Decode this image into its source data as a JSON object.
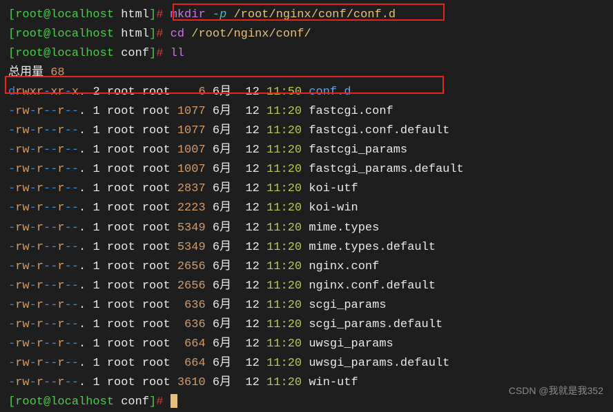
{
  "prompt1": {
    "bracket_open": "[",
    "user_host": "root@localhost",
    "dir": " html",
    "bracket_close": "]",
    "hash": "# ",
    "cmd": "mkdir ",
    "flag": "-p ",
    "path": "/root/nginx/conf/conf.d"
  },
  "prompt2": {
    "bracket_open": "[",
    "user_host": "root@localhost",
    "dir": " html",
    "bracket_close": "]",
    "hash": "# ",
    "cmd": "cd ",
    "path": "/root/nginx/conf/"
  },
  "prompt3": {
    "bracket_open": "[",
    "user_host": "root@localhost",
    "dir": " conf",
    "bracket_close": "]",
    "hash": "# ",
    "cmd": "ll"
  },
  "total_label": "总用量 ",
  "total_num": "68",
  "entries": [
    {
      "perm_d": "d",
      "perm_rwx": "rwx",
      "perm_r1": "r",
      "perm_dash1": "-",
      "perm_x1": "x",
      "perm_r2": "r",
      "perm_dash2": "-",
      "perm_x2": "x",
      "perm_end": ". ",
      "links": "2",
      "owner": " root root    ",
      "size": "6",
      "month": " 6月  ",
      "day": "12 ",
      "time": "11:50",
      "sep": " ",
      "name": "conf.d",
      "is_dir": true
    },
    {
      "perm": "-rw-r--r--. ",
      "links": "1",
      "owner": " root root ",
      "size": "1077",
      "month": " 6月  ",
      "day": "12 ",
      "time": "11:20",
      "sep": " ",
      "name": "fastcgi.conf"
    },
    {
      "perm": "-rw-r--r--. ",
      "links": "1",
      "owner": " root root ",
      "size": "1077",
      "month": " 6月  ",
      "day": "12 ",
      "time": "11:20",
      "sep": " ",
      "name": "fastcgi.conf.default"
    },
    {
      "perm": "-rw-r--r--. ",
      "links": "1",
      "owner": " root root ",
      "size": "1007",
      "month": " 6月  ",
      "day": "12 ",
      "time": "11:20",
      "sep": " ",
      "name": "fastcgi_params"
    },
    {
      "perm": "-rw-r--r--. ",
      "links": "1",
      "owner": " root root ",
      "size": "1007",
      "month": " 6月  ",
      "day": "12 ",
      "time": "11:20",
      "sep": " ",
      "name": "fastcgi_params.default"
    },
    {
      "perm": "-rw-r--r--. ",
      "links": "1",
      "owner": " root root ",
      "size": "2837",
      "month": " 6月  ",
      "day": "12 ",
      "time": "11:20",
      "sep": " ",
      "name": "koi-utf"
    },
    {
      "perm": "-rw-r--r--. ",
      "links": "1",
      "owner": " root root ",
      "size": "2223",
      "month": " 6月  ",
      "day": "12 ",
      "time": "11:20",
      "sep": " ",
      "name": "koi-win"
    },
    {
      "perm": "-rw-r--r--. ",
      "links": "1",
      "owner": " root root ",
      "size": "5349",
      "month": " 6月  ",
      "day": "12 ",
      "time": "11:20",
      "sep": " ",
      "name": "mime.types"
    },
    {
      "perm": "-rw-r--r--. ",
      "links": "1",
      "owner": " root root ",
      "size": "5349",
      "month": " 6月  ",
      "day": "12 ",
      "time": "11:20",
      "sep": " ",
      "name": "mime.types.default"
    },
    {
      "perm": "-rw-r--r--. ",
      "links": "1",
      "owner": " root root ",
      "size": "2656",
      "month": " 6月  ",
      "day": "12 ",
      "time": "11:20",
      "sep": " ",
      "name": "nginx.conf"
    },
    {
      "perm": "-rw-r--r--. ",
      "links": "1",
      "owner": " root root ",
      "size": "2656",
      "month": " 6月  ",
      "day": "12 ",
      "time": "11:20",
      "sep": " ",
      "name": "nginx.conf.default"
    },
    {
      "perm": "-rw-r--r--. ",
      "links": "1",
      "owner": " root root  ",
      "size": "636",
      "month": " 6月  ",
      "day": "12 ",
      "time": "11:20",
      "sep": " ",
      "name": "scgi_params"
    },
    {
      "perm": "-rw-r--r--. ",
      "links": "1",
      "owner": " root root  ",
      "size": "636",
      "month": " 6月  ",
      "day": "12 ",
      "time": "11:20",
      "sep": " ",
      "name": "scgi_params.default"
    },
    {
      "perm": "-rw-r--r--. ",
      "links": "1",
      "owner": " root root  ",
      "size": "664",
      "month": " 6月  ",
      "day": "12 ",
      "time": "11:20",
      "sep": " ",
      "name": "uwsgi_params"
    },
    {
      "perm": "-rw-r--r--. ",
      "links": "1",
      "owner": " root root  ",
      "size": "664",
      "month": " 6月  ",
      "day": "12 ",
      "time": "11:20",
      "sep": " ",
      "name": "uwsgi_params.default"
    },
    {
      "perm": "-rw-r--r--. ",
      "links": "1",
      "owner": " root root ",
      "size": "3610",
      "month": " 6月  ",
      "day": "12 ",
      "time": "11:20",
      "sep": " ",
      "name": "win-utf"
    }
  ],
  "prompt4": {
    "bracket_open": "[",
    "user_host": "root@localhost",
    "dir": " conf",
    "bracket_close": "]",
    "hash": "# "
  },
  "watermark": "CSDN @我就是我352"
}
